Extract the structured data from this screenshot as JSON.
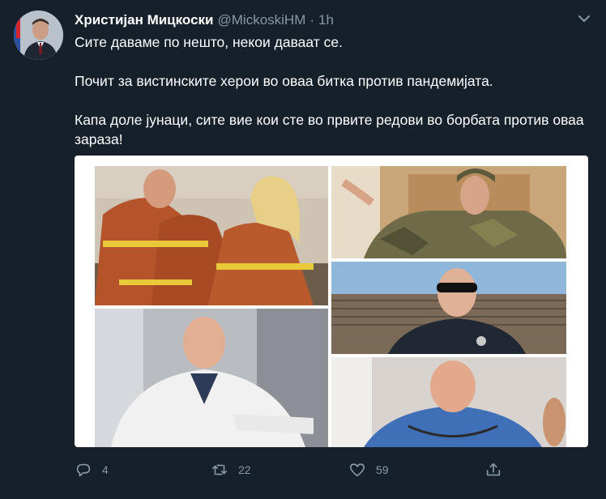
{
  "tweet": {
    "author_name": "Христијан Мицкоски",
    "handle": "@MickoskiHM",
    "separator": "·",
    "time": "1h",
    "paragraphs": [
      "Сите даваме по нешто, некои даваат се.",
      "Почит за вистинските херои во оваа битка против пандемијата.",
      "Капа доле јунаци, сите вие кои сте во првите редови во борбата против оваа зараза!"
    ]
  },
  "actions": {
    "reply_count": "4",
    "retweet_count": "22",
    "like_count": "59"
  },
  "icons": {
    "more": "chevron-down-icon",
    "reply": "reply-icon",
    "retweet": "retweet-icon",
    "like": "heart-icon",
    "share": "share-icon"
  },
  "colors": {
    "background": "#15202b",
    "secondary_text": "#8899a6",
    "primary_text": "#ffffff"
  }
}
